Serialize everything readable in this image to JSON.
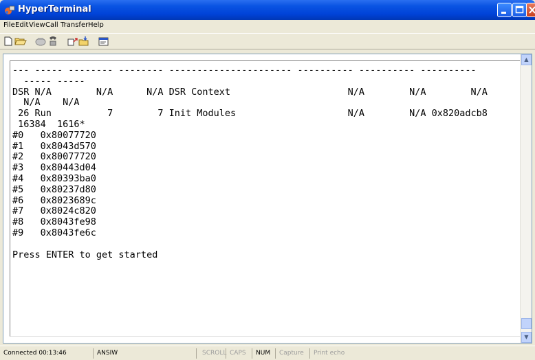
{
  "window": {
    "title": "HyperTerminal"
  },
  "menu": [
    "File",
    "Edit",
    "View",
    "Call",
    "Transfer",
    "Help"
  ],
  "terminal": {
    "lines": [
      "--- ----- -------- -------- ---------------------- ---------- ---------- ----------",
      "  ----- -----",
      "DSR N/A        N/A      N/A DSR Context                     N/A        N/A        N/A",
      "  N/A    N/A",
      " 26 Run          7        7 Init Modules                    N/A        N/A 0x820adcb8",
      " 16384  1616*",
      "#0   0x80077720",
      "#1   0x8043d570",
      "#2   0x80077720",
      "#3   0x80443d04",
      "#4   0x80393ba0",
      "#5   0x80237d80",
      "#6   0x8023689c",
      "#7   0x8024c820",
      "#8   0x8043fe98",
      "#9   0x8043fe6c",
      "",
      "Press ENTER to get started"
    ]
  },
  "status": {
    "connection": "Connected 00:13:46",
    "emulation": "ANSIW",
    "scroll": "SCROLL",
    "caps": "CAPS",
    "num": "NUM",
    "capture": "Capture",
    "print_echo": "Print echo"
  }
}
